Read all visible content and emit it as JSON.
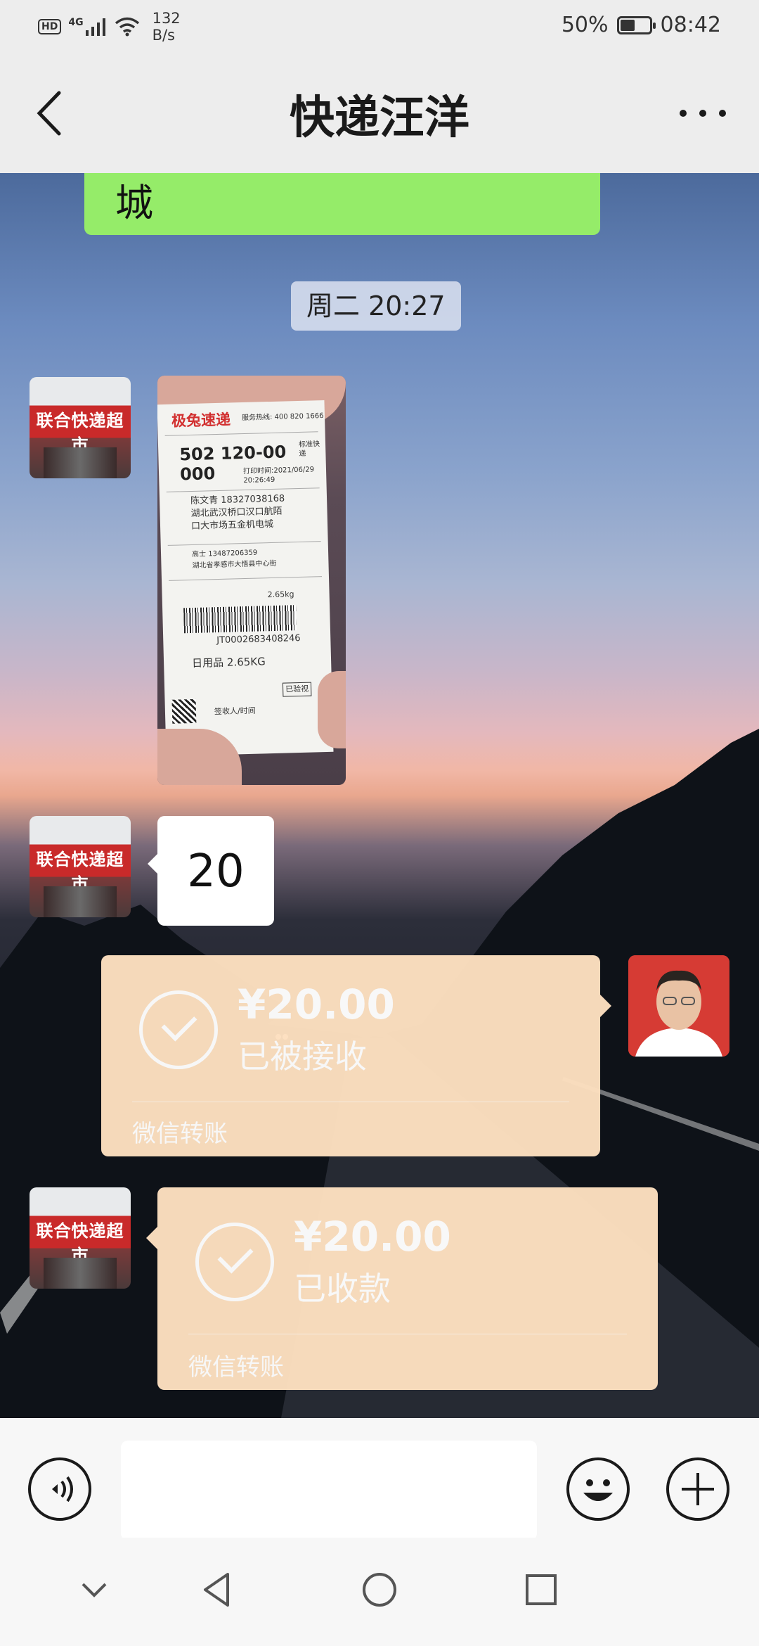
{
  "status_bar": {
    "hd": "HD",
    "network": "4G",
    "speed_value": "132",
    "speed_unit": "B/s",
    "battery": "50%",
    "battery_level": 0.5,
    "time": "08:42"
  },
  "header": {
    "title": "快递汪洋",
    "back_icon": "chevron-left-icon",
    "more_icon": "more-dots-icon"
  },
  "messages": {
    "partial_text": "城",
    "timestamp": "周二 20:27",
    "shop_avatar_sign": "联合快递超市",
    "receipt": {
      "brand": "极兔速递",
      "hotline": "服务热线: 400 820 1666",
      "code": "502 120-00 000",
      "service": "标准快递",
      "print_time": "打印时间:2021/06/29 20:26:49",
      "receiver": "陈文青 18327038168",
      "address": "湖北武汉桥口汉口航陌口大市场五金机电城",
      "sender": "高士 13487206359",
      "sender_address": "湖北省孝感市大悟县中心街",
      "weight": "2.65kg",
      "waybill": "JT0002683408246",
      "goods": "日用品 2.65KG",
      "signed": "已验视",
      "sign_label": "签收人/时间"
    },
    "reply_text": "20",
    "transfer_sent": {
      "amount": "¥20.00",
      "status": "已被接收",
      "footer": "微信转账"
    },
    "transfer_received": {
      "amount": "¥20.00",
      "status": "已收款",
      "footer": "微信转账"
    }
  },
  "input_bar": {
    "voice_icon": "voice-icon",
    "text_value": "",
    "emoji_icon": "emoji-icon",
    "plus_icon": "plus-icon"
  },
  "nav_bar": {
    "icons": [
      "collapse-chevron-icon",
      "back-triangle-icon",
      "home-circle-icon",
      "recents-square-icon"
    ]
  },
  "colors": {
    "bubble_green": "#95ec69",
    "transfer_bg": "#fde0c0",
    "header_bg": "#ededed"
  }
}
